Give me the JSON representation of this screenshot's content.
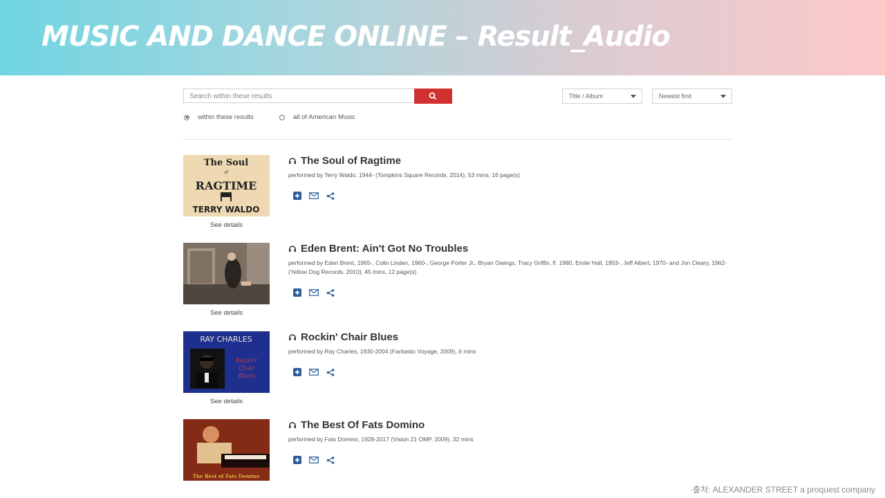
{
  "header": {
    "title": "MUSIC AND DANCE ONLINE – Result_Audio"
  },
  "search": {
    "placeholder": "Search within these results"
  },
  "sort": {
    "field": "Title / Album",
    "order": "Newest first"
  },
  "scope": {
    "option_within": "within these results",
    "option_all": "all of American Music",
    "selected": "within these results"
  },
  "results": [
    {
      "title": "The Soul of Ragtime",
      "meta": "performed by Terry Waldo, 1944- (Tompkins Square Records, 2014), 53 mins, 16 page(s)",
      "details_label": "See details",
      "cover": {
        "line1": "The Soul",
        "line2": "of",
        "line3": "RAGTIME",
        "line4": "TERRY WALDO"
      }
    },
    {
      "title": "Eden Brent: Ain't Got No Troubles",
      "meta": "performed by Eden Brent, 1965-, Colin Linden, 1960-, George Porter Jr., Bryan Owings, Tracy Griffin, fl. 1980, Emile Hall, 1953-, Jeff Albert, 1970- and Jon Cleary, 1962- (Yellow Dog Records, 2010), 45 mins, 12 page(s)",
      "details_label": "See details"
    },
    {
      "title": "Rockin' Chair Blues",
      "meta": "performed by Ray Charles, 1930-2004 (Fantastic Voyage, 2009), 6 mins",
      "details_label": "See details",
      "cover": {
        "artist": "RAY CHARLES",
        "line1": "Rockin'",
        "line2": "Chair",
        "line3": "Blues"
      }
    },
    {
      "title": "The Best Of Fats Domino",
      "meta": "performed by Fats Domino, 1928-2017 (Vision 21 OMP, 2009), 32 mins",
      "cover": {
        "text": "The Best of Fats Domino"
      }
    }
  ],
  "footer": {
    "source": "·출처: ALEXANDER STREET a proquest company"
  },
  "colors": {
    "search_button": "#d0302f",
    "action_icon": "#2c5f9a"
  }
}
